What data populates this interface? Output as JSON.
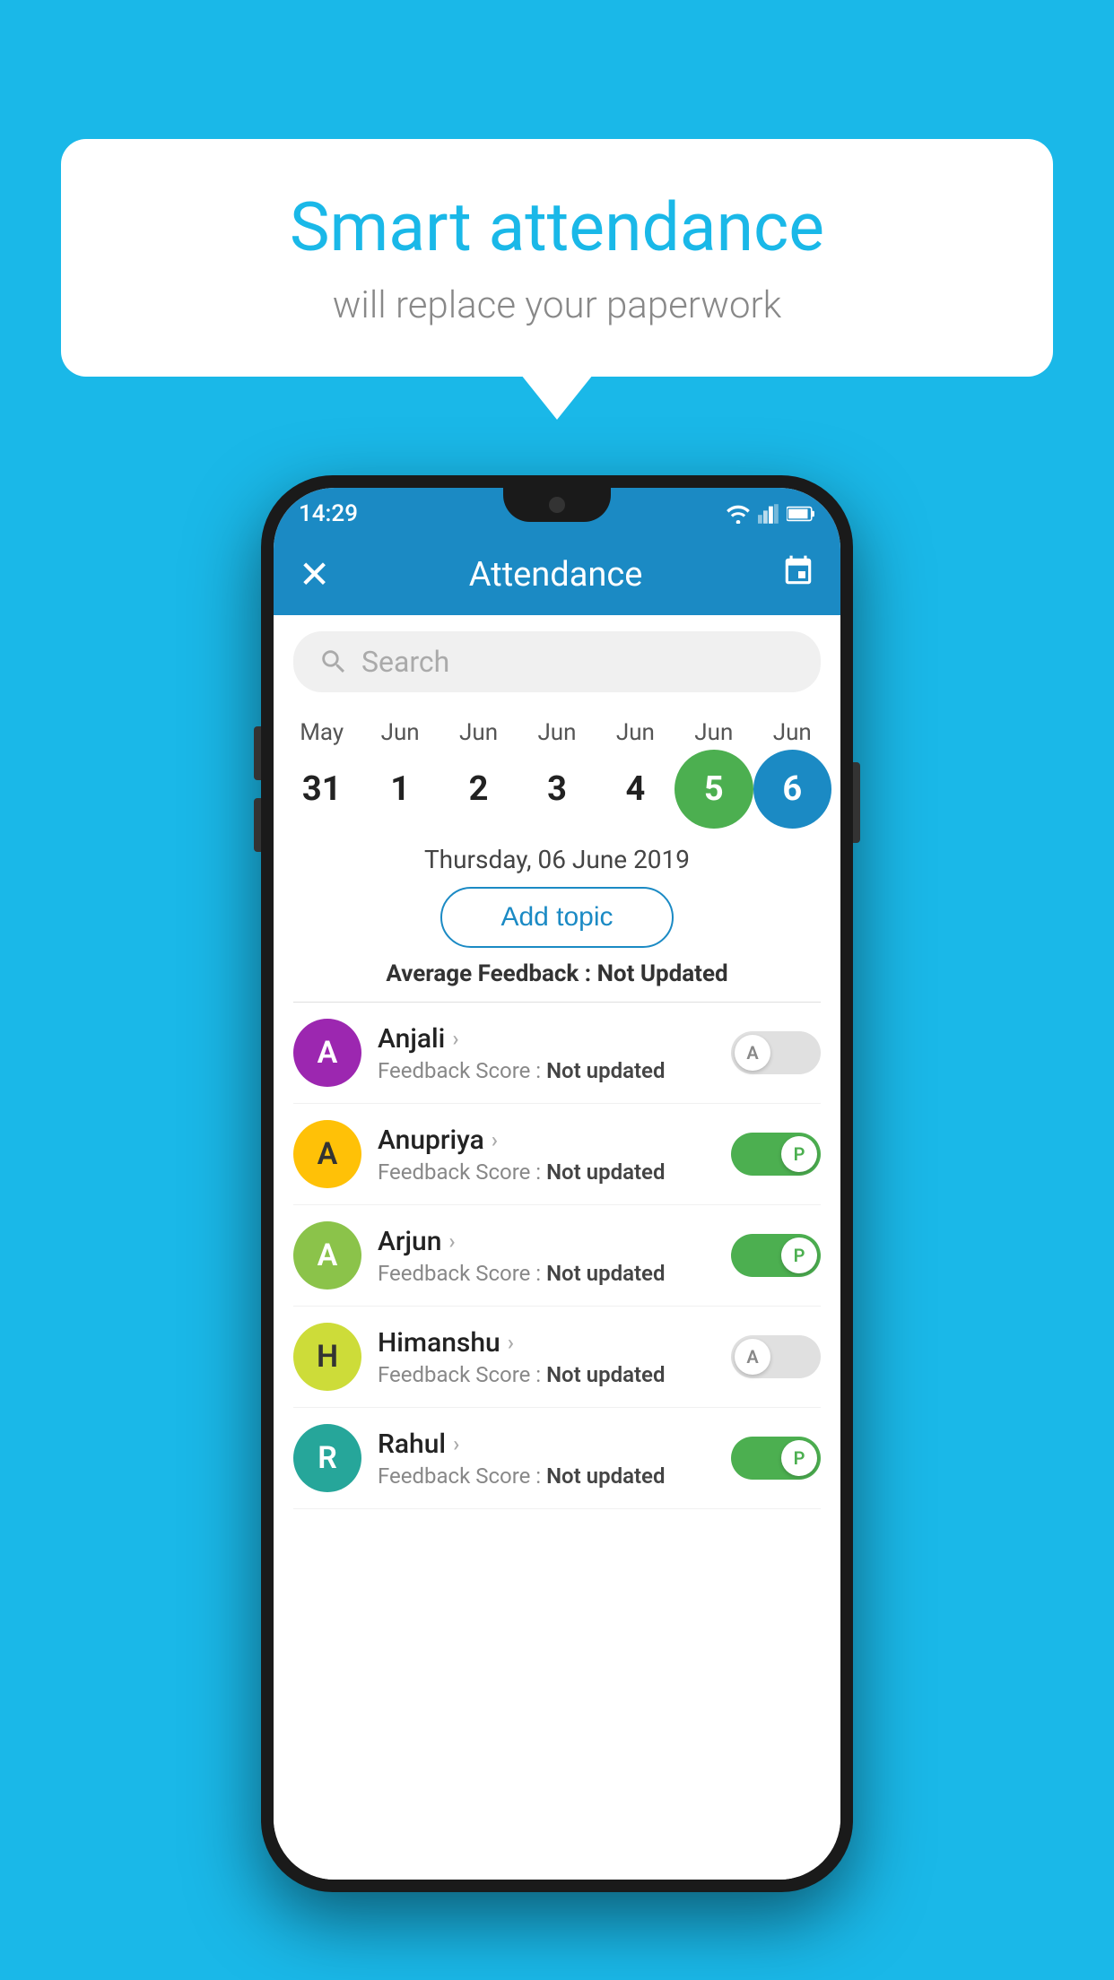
{
  "background": {
    "color": "#1ab8e8"
  },
  "speech_bubble": {
    "title": "Smart attendance",
    "subtitle": "will replace your paperwork"
  },
  "status_bar": {
    "time": "14:29"
  },
  "app_header": {
    "title": "Attendance",
    "close_icon": "×",
    "calendar_icon": "📅"
  },
  "search": {
    "placeholder": "Search"
  },
  "calendar": {
    "months": [
      "May",
      "Jun",
      "Jun",
      "Jun",
      "Jun",
      "Jun",
      "Jun"
    ],
    "days": [
      "31",
      "1",
      "2",
      "3",
      "4",
      "5",
      "6"
    ],
    "states": [
      "normal",
      "normal",
      "normal",
      "normal",
      "normal",
      "today",
      "selected"
    ]
  },
  "selected_date": "Thursday, 06 June 2019",
  "add_topic_label": "Add topic",
  "average_feedback": {
    "label": "Average Feedback : ",
    "value": "Not Updated"
  },
  "students": [
    {
      "name": "Anjali",
      "avatar_letter": "A",
      "avatar_color": "purple",
      "feedback_label": "Feedback Score : ",
      "feedback_value": "Not updated",
      "toggle_state": "off",
      "toggle_label": "A"
    },
    {
      "name": "Anupriya",
      "avatar_letter": "A",
      "avatar_color": "yellow",
      "feedback_label": "Feedback Score : ",
      "feedback_value": "Not updated",
      "toggle_state": "on",
      "toggle_label": "P"
    },
    {
      "name": "Arjun",
      "avatar_letter": "A",
      "avatar_color": "green-light",
      "feedback_label": "Feedback Score : ",
      "feedback_value": "Not updated",
      "toggle_state": "on",
      "toggle_label": "P"
    },
    {
      "name": "Himanshu",
      "avatar_letter": "H",
      "avatar_color": "olive",
      "feedback_label": "Feedback Score : ",
      "feedback_value": "Not updated",
      "toggle_state": "off",
      "toggle_label": "A"
    },
    {
      "name": "Rahul",
      "avatar_letter": "R",
      "avatar_color": "teal",
      "feedback_label": "Feedback Score : ",
      "feedback_value": "Not updated",
      "toggle_state": "on",
      "toggle_label": "P"
    }
  ]
}
